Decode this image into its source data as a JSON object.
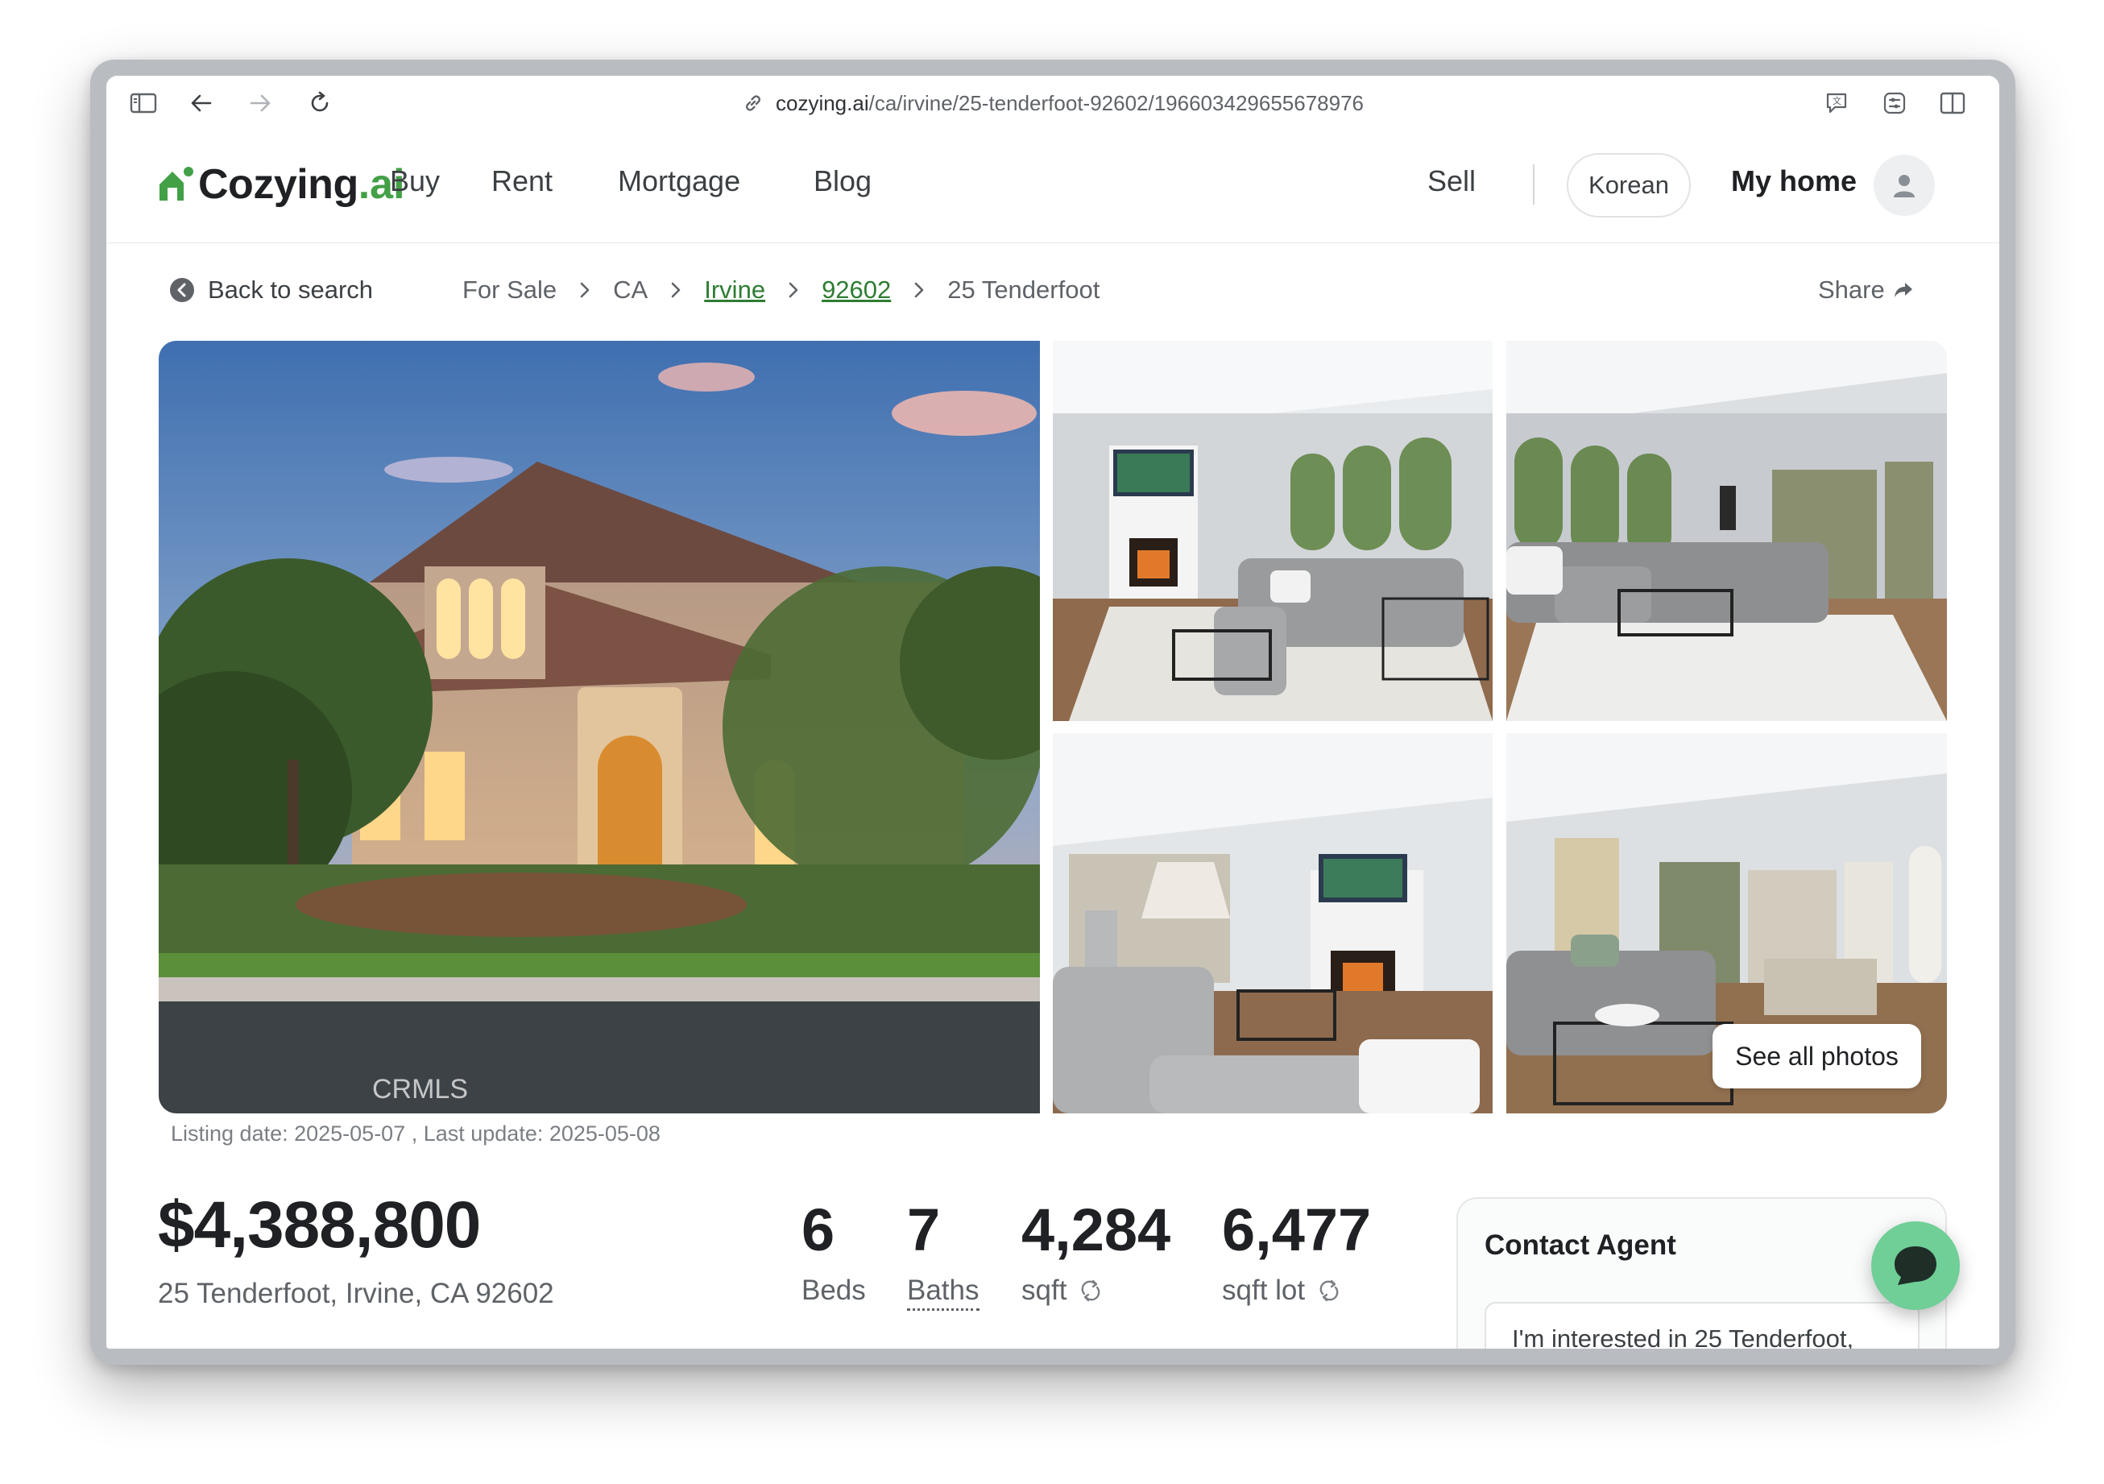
{
  "browser": {
    "url_domain": "cozying.ai",
    "url_path": "/ca/irvine/25-tenderfoot-92602/196603429655678976"
  },
  "header": {
    "logo_text": "Cozying",
    "logo_suffix": ".ai",
    "nav": [
      "Buy",
      "Rent",
      "Mortgage",
      "Blog"
    ],
    "sell": "Sell",
    "language": "Korean",
    "my_home": "My home"
  },
  "breadcrumb": {
    "back": "Back to search",
    "items": [
      "For Sale",
      "CA",
      "Irvine",
      "92602",
      "25 Tenderfoot"
    ],
    "share": "Share"
  },
  "photos": {
    "see_all": "See all photos",
    "watermark": "CRMLS"
  },
  "listing": {
    "dates": "Listing date:  2025-05-07 , Last update:  2025-05-08",
    "price": "$4,388,800",
    "address": "25 Tenderfoot, Irvine, CA 92602",
    "stats": [
      {
        "value": "6",
        "label": "Beds"
      },
      {
        "value": "7",
        "label": "Baths"
      },
      {
        "value": "4,284",
        "label": "sqft"
      },
      {
        "value": "6,477",
        "label": "sqft lot"
      }
    ]
  },
  "contact": {
    "title": "Contact Agent",
    "message": "I'm interested in 25 Tenderfoot,"
  },
  "colors": {
    "brand_green": "#43a047",
    "link_green": "#2e7d32",
    "chat_green": "#6fcf97"
  }
}
